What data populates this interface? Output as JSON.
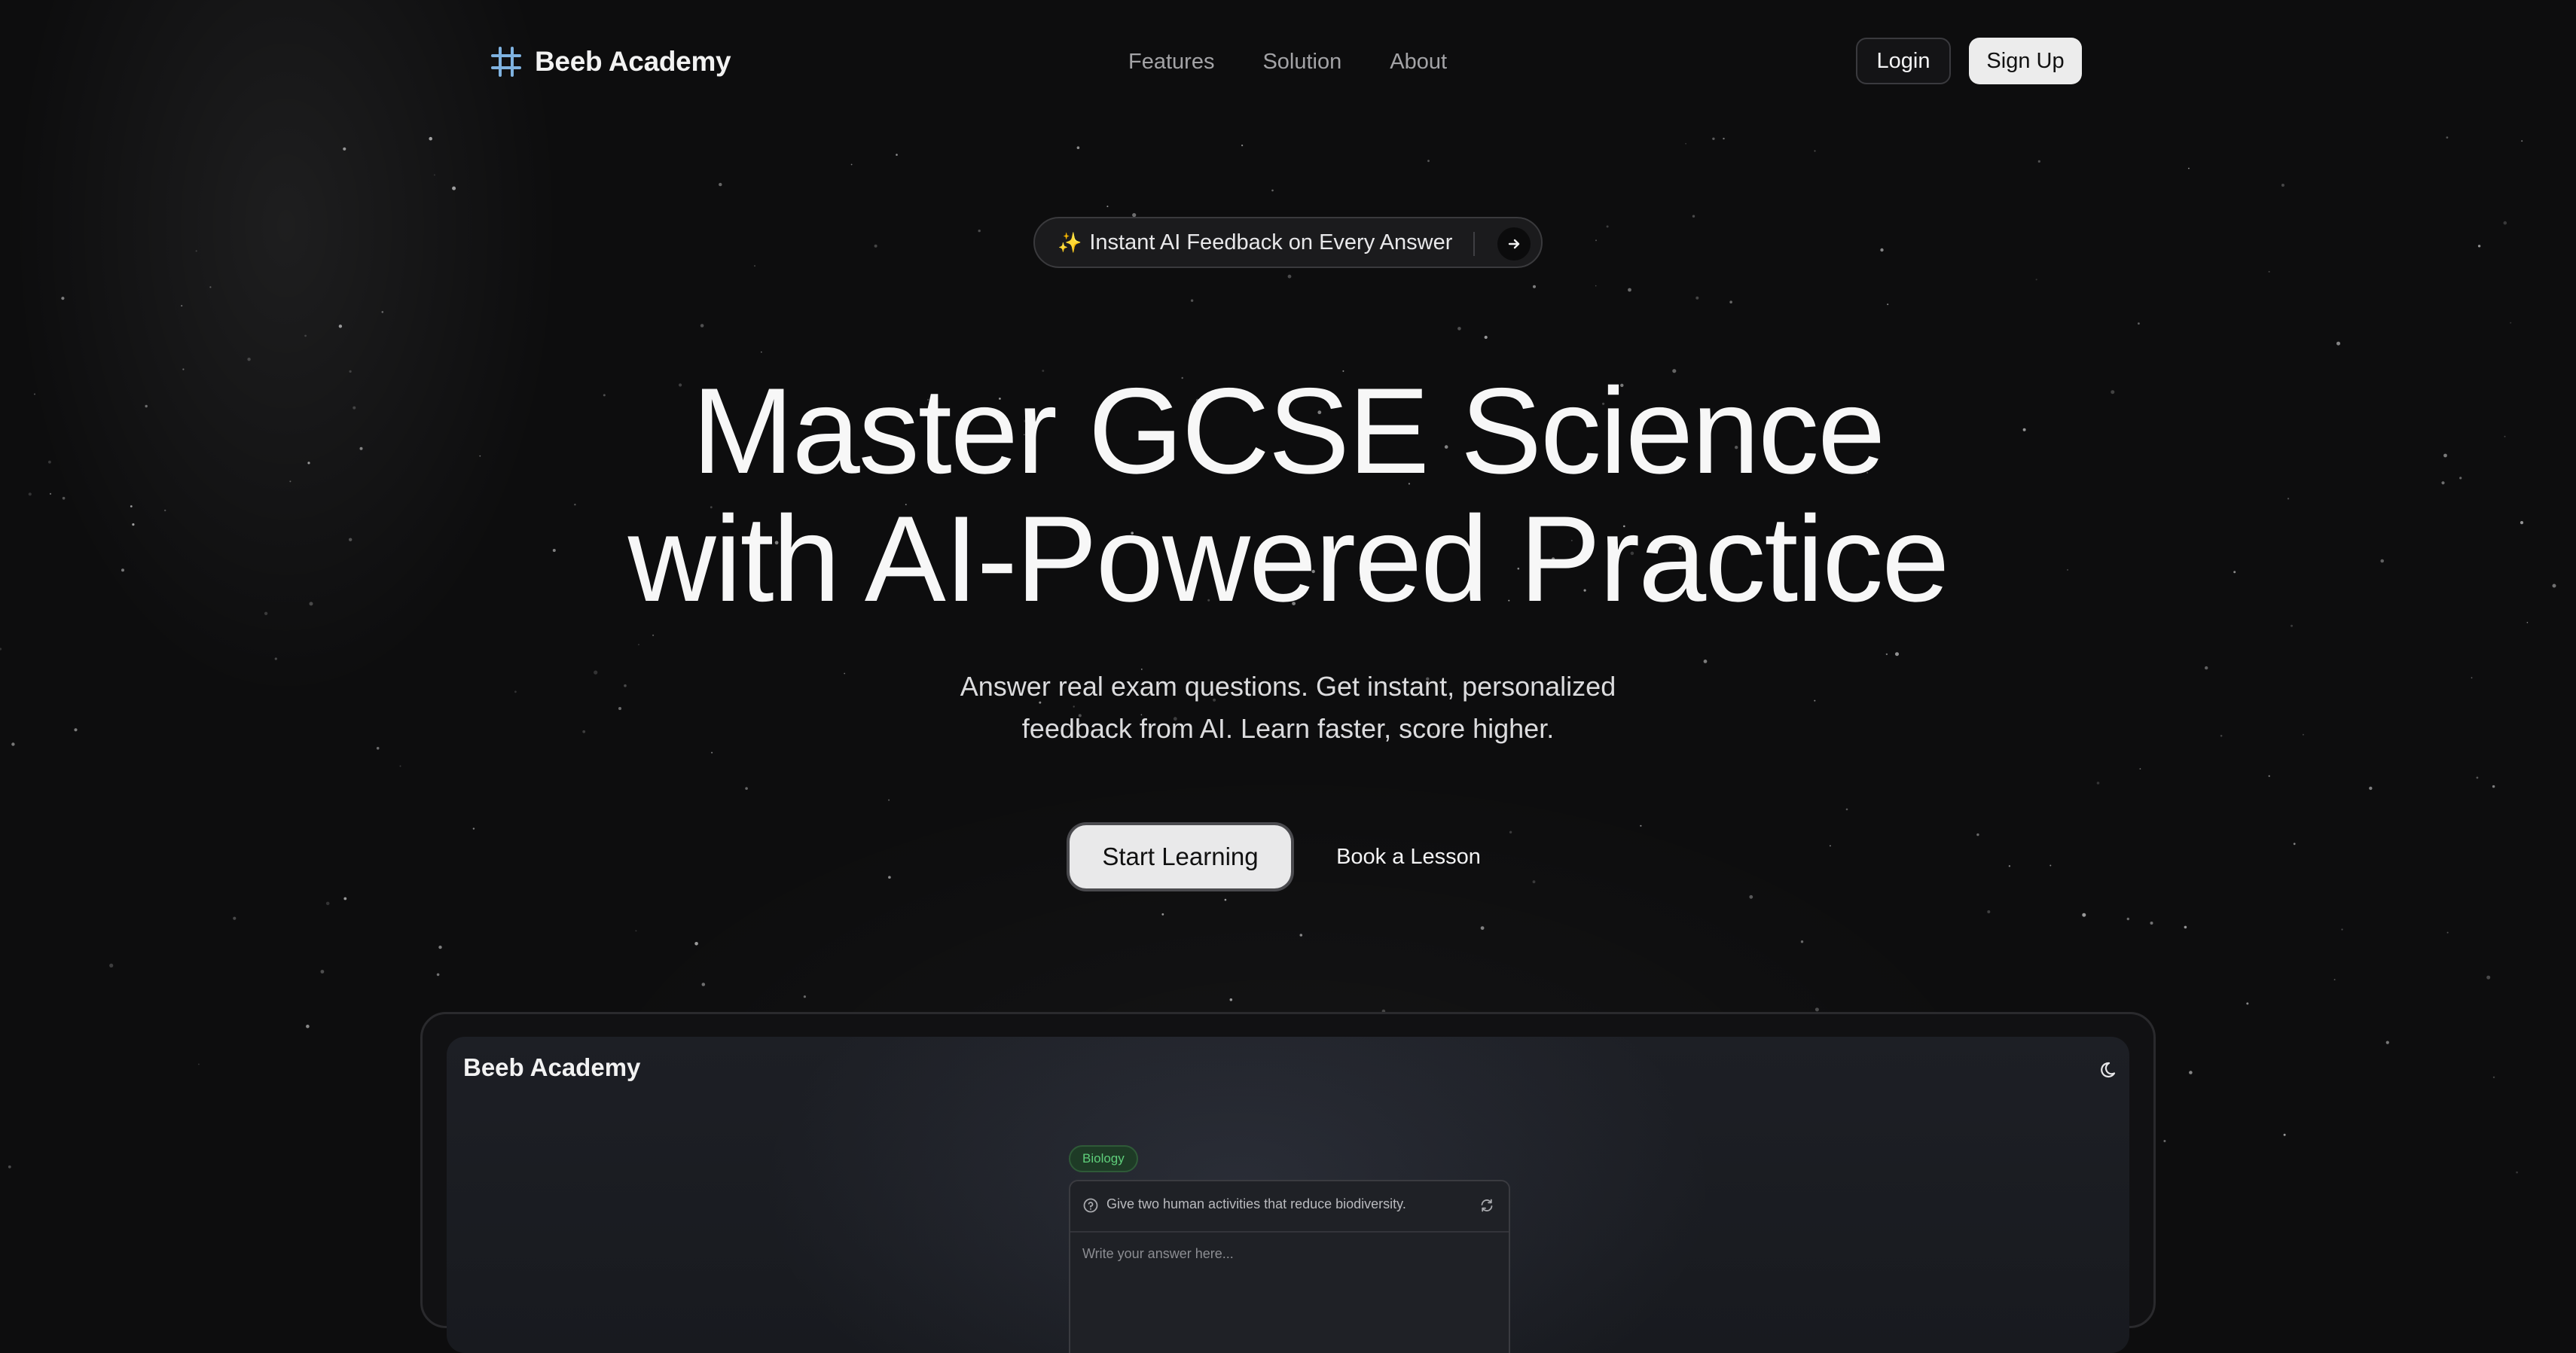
{
  "nav": {
    "brand": "Beeb Academy",
    "links": [
      "Features",
      "Solution",
      "About"
    ],
    "login_label": "Login",
    "signup_label": "Sign Up"
  },
  "announcement": {
    "text": "Instant AI Feedback on Every Answer",
    "sparkle_icon": "sparkles-icon",
    "arrow_icon": "arrow-right-icon"
  },
  "hero": {
    "title_line1": "Master GCSE Science",
    "title_line2": "with AI-Powered Practice",
    "subtitle_line1": "Answer real exam questions. Get instant, personalized",
    "subtitle_line2": "feedback from AI. Learn faster, score higher.",
    "primary_cta": "Start Learning",
    "secondary_cta": "Book a Lesson"
  },
  "preview": {
    "brand": "Beeb Academy",
    "theme_icon": "moon-icon",
    "subject_tag": "Biology",
    "question": "Give two human activities that reduce biodiversity.",
    "answer_placeholder": "Write your answer here...",
    "tag_color": "#5fcf7b"
  },
  "colors": {
    "background": "#0d0d0e",
    "logo_icon": "#7fb2e0",
    "primary_button": "#e9e9ea"
  }
}
